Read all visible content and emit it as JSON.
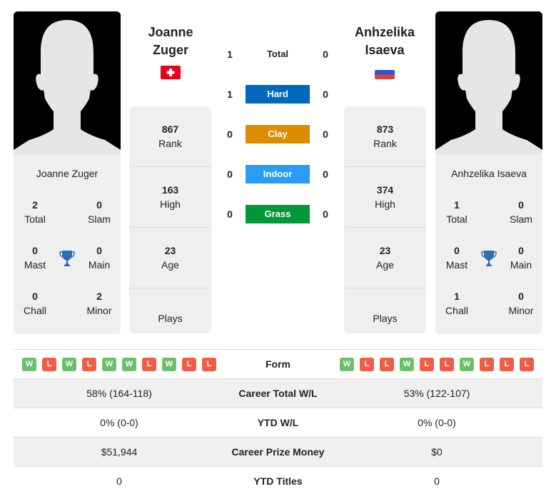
{
  "player1": {
    "name_line1": "Joanne",
    "name_line2": "Zuger",
    "full_name": "Joanne Zuger",
    "flag": "switzerland-flag",
    "rank": "867",
    "rank_label": "Rank",
    "high": "163",
    "high_label": "High",
    "age": "23",
    "age_label": "Age",
    "plays_label": "Plays",
    "titles": {
      "total": "2",
      "total_label": "Total",
      "slam": "0",
      "slam_label": "Slam",
      "mast": "0",
      "mast_label": "Mast",
      "main": "0",
      "main_label": "Main",
      "chall": "0",
      "chall_label": "Chall",
      "minor": "2",
      "minor_label": "Minor"
    },
    "form": [
      "W",
      "L",
      "W",
      "L",
      "W",
      "W",
      "L",
      "W",
      "L",
      "L"
    ],
    "career_wl": "58% (164-118)",
    "ytd_wl": "0% (0-0)",
    "prize": "$51,944",
    "ytd_titles": "0"
  },
  "player2": {
    "name_line1": "Anhzelika",
    "name_line2": "Isaeva",
    "full_name": "Anhzelika Isaeva",
    "flag": "russia-flag",
    "rank": "873",
    "rank_label": "Rank",
    "high": "374",
    "high_label": "High",
    "age": "23",
    "age_label": "Age",
    "plays_label": "Plays",
    "titles": {
      "total": "1",
      "total_label": "Total",
      "slam": "0",
      "slam_label": "Slam",
      "mast": "0",
      "mast_label": "Mast",
      "main": "0",
      "main_label": "Main",
      "chall": "1",
      "chall_label": "Chall",
      "minor": "0",
      "minor_label": "Minor"
    },
    "form": [
      "W",
      "L",
      "L",
      "W",
      "L",
      "L",
      "W",
      "L",
      "L",
      "L"
    ],
    "career_wl": "53% (122-107)",
    "ytd_wl": "0% (0-0)",
    "prize": "$0",
    "ytd_titles": "0"
  },
  "h2h": [
    {
      "label": "Total",
      "p1": "1",
      "p2": "0",
      "color": ""
    },
    {
      "label": "Hard",
      "p1": "1",
      "p2": "0",
      "color": "#0068bd"
    },
    {
      "label": "Clay",
      "p1": "0",
      "p2": "0",
      "color": "#dd8c00"
    },
    {
      "label": "Indoor",
      "p1": "0",
      "p2": "0",
      "color": "#2a9cf5"
    },
    {
      "label": "Grass",
      "p1": "0",
      "p2": "0",
      "color": "#03973a"
    }
  ],
  "rows": {
    "form": "Form",
    "career_wl": "Career Total W/L",
    "ytd_wl": "YTD W/L",
    "prize": "Career Prize Money",
    "ytd_titles": "YTD Titles"
  },
  "colors": {
    "win": "#6cbf6c",
    "loss": "#ee5e47",
    "trophy": "#2f6db5"
  }
}
